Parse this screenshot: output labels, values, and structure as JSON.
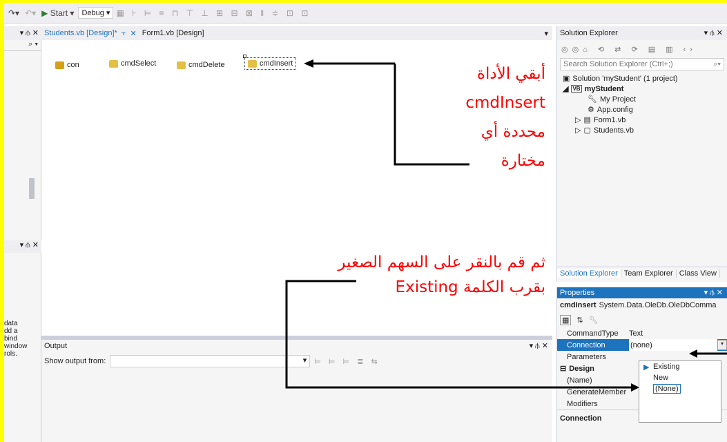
{
  "toolbar": {
    "start_label": "Start",
    "config_label": "Debug"
  },
  "tabs": [
    {
      "label": "Students.vb [Design]*"
    },
    {
      "label": "Form1.vb [Design]"
    }
  ],
  "designer": {
    "components": [
      "con",
      "cmdSelect",
      "cmdDelete",
      "cmdInsert"
    ]
  },
  "annotations": {
    "note1_line1": "أبقي الأداة",
    "note1_line2": "cmdInsert",
    "note1_line3": "محددة أي",
    "note1_line4": "مختارة",
    "note2_line1": "ثم قم بالنقر على السهم الصغير",
    "note2_line2": "بقرب الكلمة Existing"
  },
  "left_panel": {
    "text_lines": [
      "data",
      "dd a",
      "bind",
      "window",
      "rols."
    ]
  },
  "output": {
    "title": "Output",
    "show_from_label": "Show output from:"
  },
  "solution_explorer": {
    "title": "Solution Explorer",
    "search_placeholder": "Search Solution Explorer (Ctrl+;)",
    "solution_label": "Solution 'myStudent' (1 project)",
    "project_label": "myStudent",
    "items": [
      "My Project",
      "App.config",
      "Form1.vb",
      "Students.vb"
    ],
    "bottom_tabs": [
      "Solution Explorer",
      "Team Explorer",
      "Class View"
    ]
  },
  "properties": {
    "title": "Properties",
    "object_name": "cmdInsert",
    "object_type": "System.Data.OleDb.OleDbComma",
    "rows": [
      {
        "name": "CommandType",
        "value": "Text"
      },
      {
        "name": "Connection",
        "value": "(none)"
      },
      {
        "name": "Parameters",
        "value": ""
      }
    ],
    "design_category": "Design",
    "design_rows": [
      {
        "name": "(Name)"
      },
      {
        "name": "GenerateMember"
      },
      {
        "name": "Modifiers"
      }
    ],
    "description_title": "Connection"
  },
  "connection_dropdown": {
    "options": [
      "Existing",
      "New",
      "(None)"
    ]
  },
  "colors": {
    "accent": "#1e73be",
    "annotation": "#ff0000",
    "highlight": "#ffff00"
  }
}
